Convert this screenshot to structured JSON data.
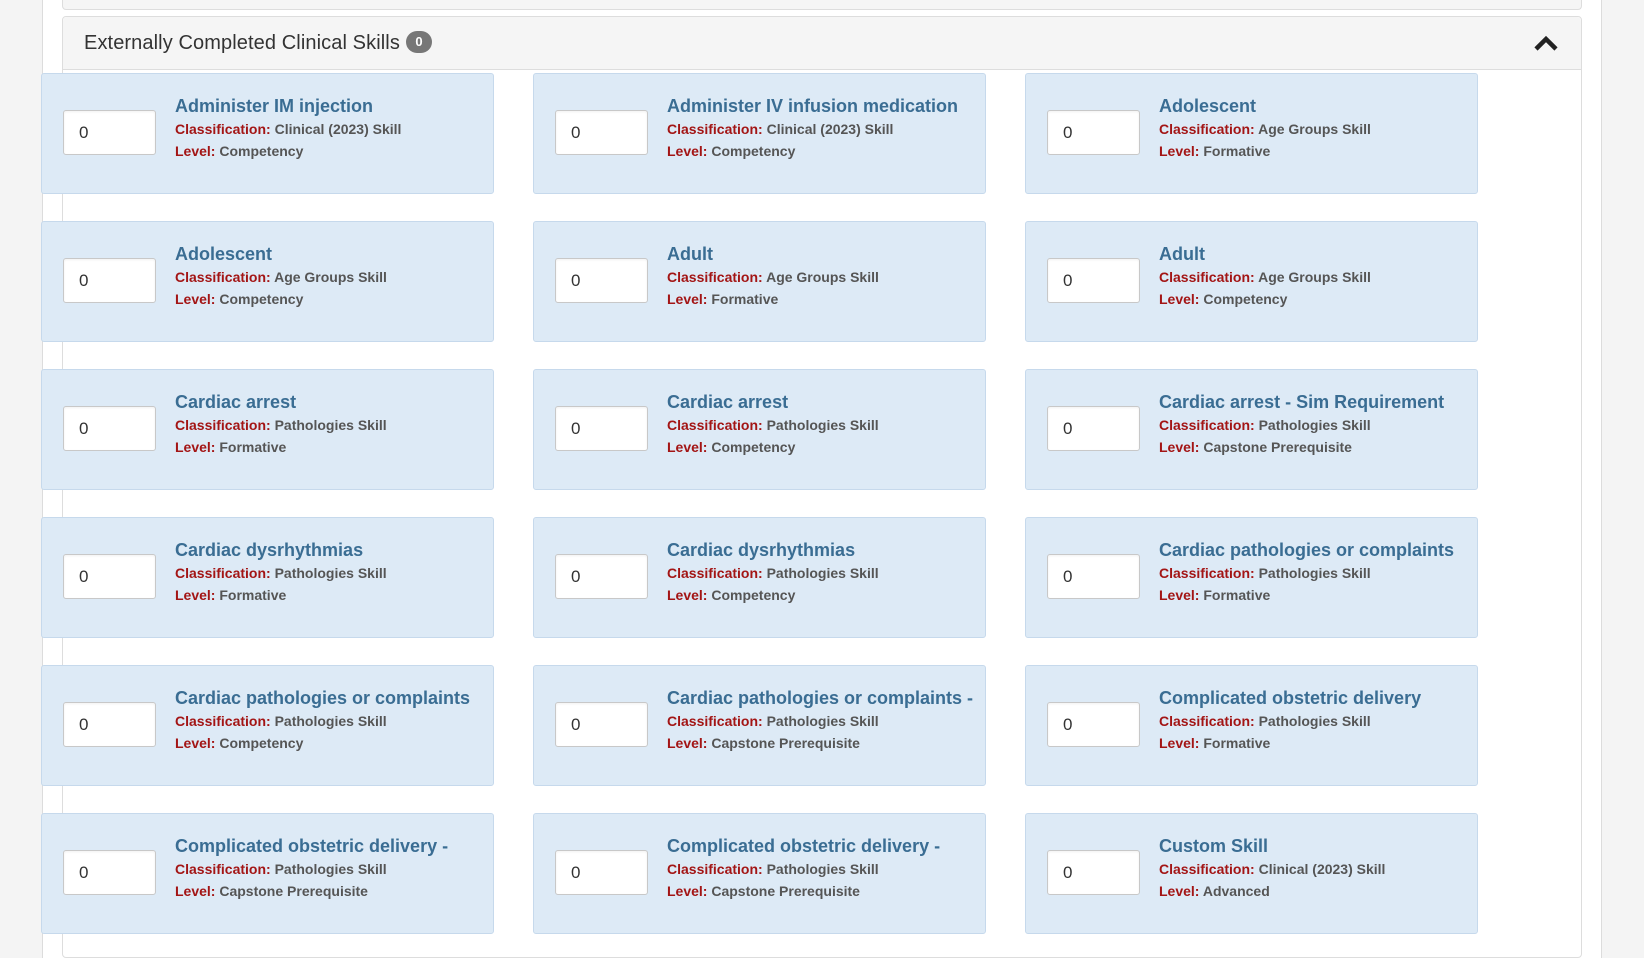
{
  "panel": {
    "title": "Externally Completed Clinical Skills",
    "badge_count": "0"
  },
  "labels": {
    "classification": "Classification:",
    "level": "Level:"
  },
  "colors": {
    "card_bg": "#ddeaf6",
    "skill_name": "#3a6d93",
    "label_red": "#a31515",
    "badge_bg": "#777777"
  },
  "icons": {
    "collapse": "chevron-up-icon"
  },
  "skills": [
    {
      "name": "Administer IM injection",
      "classification": "Clinical (2023) Skill",
      "level": "Competency",
      "value": "0"
    },
    {
      "name": "Administer IV infusion medication",
      "classification": "Clinical (2023) Skill",
      "level": "Competency",
      "value": "0"
    },
    {
      "name": "Adolescent",
      "classification": "Age Groups Skill",
      "level": "Formative",
      "value": "0"
    },
    {
      "name": "Adolescent",
      "classification": "Age Groups Skill",
      "level": "Competency",
      "value": "0"
    },
    {
      "name": "Adult",
      "classification": "Age Groups Skill",
      "level": "Formative",
      "value": "0"
    },
    {
      "name": "Adult",
      "classification": "Age Groups Skill",
      "level": "Competency",
      "value": "0"
    },
    {
      "name": "Cardiac arrest",
      "classification": "Pathologies Skill",
      "level": "Formative",
      "value": "0"
    },
    {
      "name": "Cardiac arrest",
      "classification": "Pathologies Skill",
      "level": "Competency",
      "value": "0"
    },
    {
      "name": "Cardiac arrest - Sim Requirement",
      "classification": "Pathologies Skill",
      "level": "Capstone Prerequisite",
      "value": "0"
    },
    {
      "name": "Cardiac dysrhythmias",
      "classification": "Pathologies Skill",
      "level": "Formative",
      "value": "0"
    },
    {
      "name": "Cardiac dysrhythmias",
      "classification": "Pathologies Skill",
      "level": "Competency",
      "value": "0"
    },
    {
      "name": "Cardiac pathologies or complaints",
      "classification": "Pathologies Skill",
      "level": "Formative",
      "value": "0"
    },
    {
      "name": "Cardiac pathologies or complaints",
      "classification": "Pathologies Skill",
      "level": "Competency",
      "value": "0"
    },
    {
      "name": "Cardiac pathologies or complaints -",
      "classification": "Pathologies Skill",
      "level": "Capstone Prerequisite",
      "value": "0"
    },
    {
      "name": "Complicated obstetric delivery",
      "classification": "Pathologies Skill",
      "level": "Formative",
      "value": "0"
    },
    {
      "name": "Complicated obstetric delivery -",
      "classification": "Pathologies Skill",
      "level": "Capstone Prerequisite",
      "value": "0"
    },
    {
      "name": "Complicated obstetric delivery -",
      "classification": "Pathologies Skill",
      "level": "Capstone Prerequisite",
      "value": "0"
    },
    {
      "name": "Custom Skill",
      "classification": "Clinical (2023) Skill",
      "level": "Advanced",
      "value": "0"
    }
  ]
}
